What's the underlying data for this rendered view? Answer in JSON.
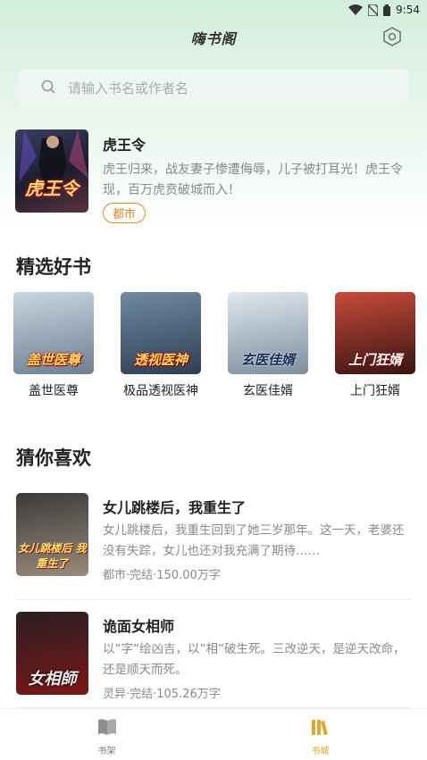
{
  "status": {
    "time": "9:54"
  },
  "header": {
    "title": "嗨书阁"
  },
  "search": {
    "placeholder": "请输入书名或作者名"
  },
  "featured": {
    "title": "虎王令",
    "description": "虎王归来，战友妻子惨遭侮辱，儿子被打耳光！虎王令现，百万虎贲破城而入！",
    "tag": "都市",
    "cover_text": "虎王令"
  },
  "sections": {
    "picks_title": "精选好书",
    "recommend_title": "猜你喜欢"
  },
  "picks": [
    {
      "name": "盖世医尊",
      "cover_text": "盖世医尊",
      "colors": [
        "#c9d6e0",
        "#6d7f92"
      ]
    },
    {
      "name": "极品透视医神",
      "cover_text": "透视医神",
      "colors": [
        "#6f8aa3",
        "#2f3e52"
      ]
    },
    {
      "name": "玄医佳婿",
      "cover_text": "玄医佳婿",
      "colors": [
        "#dfe8ef",
        "#7c8e9f"
      ]
    },
    {
      "name": "上门狂婿",
      "cover_text": "上门狂婿",
      "colors": [
        "#c84a3a",
        "#3a1412"
      ]
    }
  ],
  "recommend": [
    {
      "title": "女儿跳楼后，我重生了",
      "description": "女儿跳楼后，我重生回到了她三岁那年。这一天，老婆还没有失踪，女儿也还对我充满了期待……",
      "meta": "都市·完结·150.00万字",
      "cover_text": "女儿跳楼后 我重生了",
      "colors": [
        "#3b3b3b",
        "#9a8a7a"
      ]
    },
    {
      "title": "诡面女相师",
      "description": "以”字”绘凶吉，以”相”破生死。三改逆天，是逆天改命，还是顺天而死。",
      "meta": "灵异·完结·105.26万字",
      "cover_text": "女相師",
      "colors": [
        "#2a1e22",
        "#7a1818"
      ]
    }
  ],
  "bottom_nav": [
    {
      "label": "书架",
      "icon": "book-open-icon",
      "active": false
    },
    {
      "label": "书城",
      "icon": "library-icon",
      "active": true
    }
  ],
  "colors": {
    "accent": "#e8a427",
    "tag": "#e0892a",
    "header_bg": "#d3eedd"
  }
}
